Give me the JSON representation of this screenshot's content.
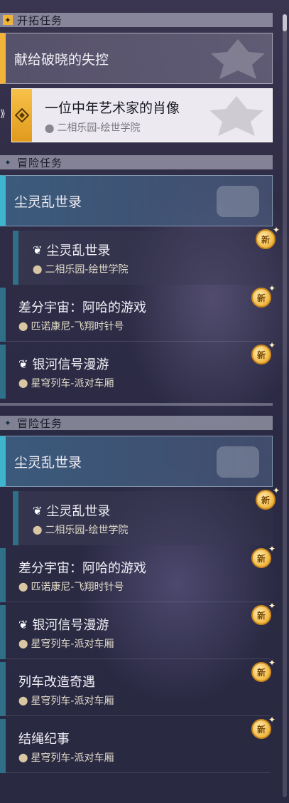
{
  "section_pioneer": {
    "title": "开拓任务"
  },
  "pioneer_main": {
    "title": "献给破晓的失控"
  },
  "pioneer_selected": {
    "title": "一位中年艺术家的肖像",
    "location": "二相乐园-绘世学院"
  },
  "adventure_1": {
    "header": "冒险任务",
    "main": "尘灵乱世录",
    "items": [
      {
        "title": "尘灵乱世录",
        "location": "二相乐园-绘世学院",
        "badge": "新"
      },
      {
        "title": "差分宇宙：阿哈的游戏",
        "location": "匹诺康尼-飞翔时针号",
        "badge": "新"
      },
      {
        "title": "银河信号漫游",
        "location": "星穹列车-派对车厢",
        "badge": "新"
      }
    ]
  },
  "adventure_2": {
    "header": "冒险任务",
    "main": "尘灵乱世录",
    "items": [
      {
        "title": "尘灵乱世录",
        "location": "二相乐园-绘世学院",
        "badge": "新"
      },
      {
        "title": "差分宇宙：阿哈的游戏",
        "location": "匹诺康尼-飞翔时针号",
        "badge": "新"
      },
      {
        "title": "银河信号漫游",
        "location": "星穹列车-派对车厢",
        "badge": "新"
      },
      {
        "title": "列车改造奇遇",
        "location": "星穹列车-派对车厢",
        "badge": "新"
      },
      {
        "title": "结绳纪事",
        "location": "星穹列车-派对车厢",
        "badge": "新"
      }
    ]
  },
  "colors": {
    "pioneer_accent": "#f0b43a",
    "adventure_accent": "#3fb4cf",
    "badge": "#f0b43a"
  }
}
